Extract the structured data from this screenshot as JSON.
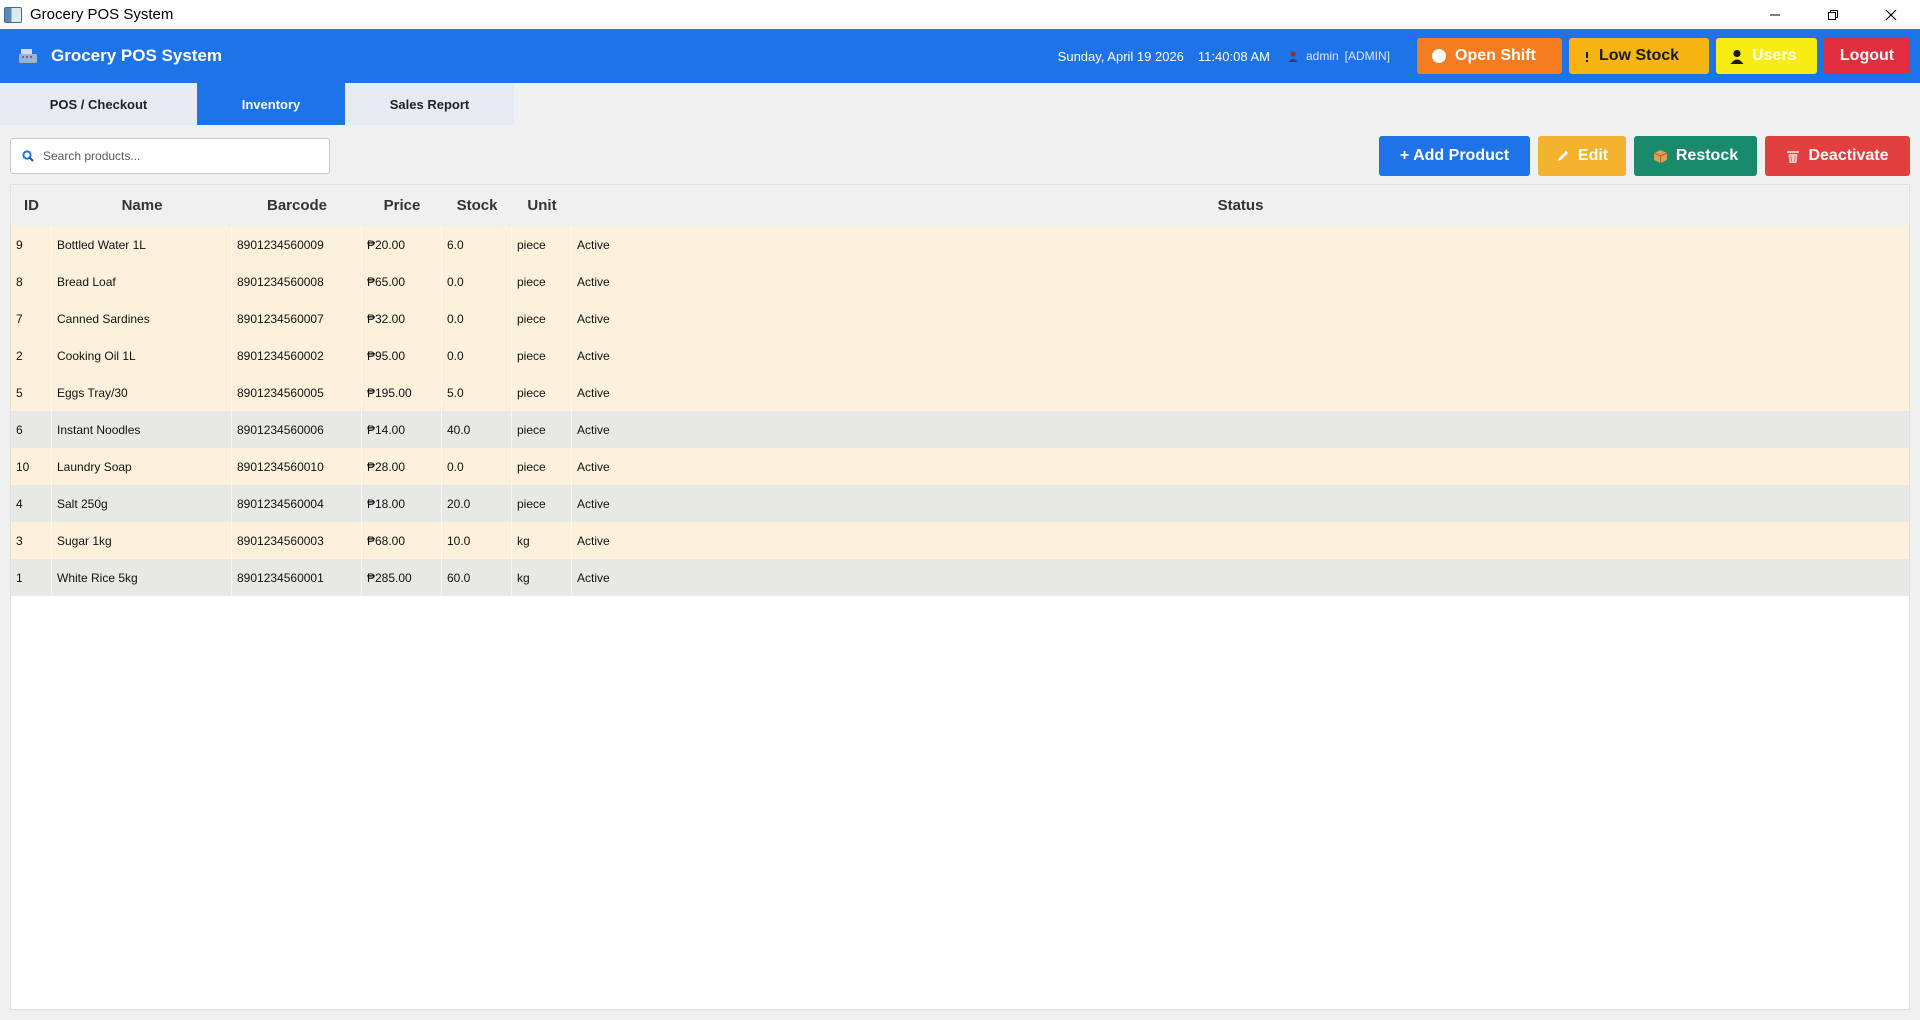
{
  "window": {
    "title": "Grocery POS System"
  },
  "header": {
    "brand": "Grocery POS System",
    "date": "Sunday, April 19 2026",
    "time": "11:40:08 AM",
    "user": "admin",
    "role": "[ADMIN]",
    "buttons": {
      "open_shift": "Open Shift",
      "low_stock": "Low Stock",
      "users": "Users",
      "logout": "Logout"
    }
  },
  "tabs": [
    {
      "label": "POS / Checkout",
      "active": false
    },
    {
      "label": "Inventory",
      "active": true
    },
    {
      "label": "Sales Report",
      "active": false
    }
  ],
  "search": {
    "placeholder": "Search products...",
    "value": ""
  },
  "toolbar": {
    "add": "+ Add Product",
    "edit": "Edit",
    "restock": "Restock",
    "deactivate": "Deactivate"
  },
  "table": {
    "columns": [
      "ID",
      "Name",
      "Barcode",
      "Price",
      "Stock",
      "Unit",
      "Status"
    ],
    "rows": [
      {
        "id": "9",
        "name": "Bottled Water 1L",
        "barcode": "8901234560009",
        "price": "₱20.00",
        "stock": "6.0",
        "unit": "piece",
        "status": "Active",
        "low": true
      },
      {
        "id": "8",
        "name": "Bread Loaf",
        "barcode": "8901234560008",
        "price": "₱65.00",
        "stock": "0.0",
        "unit": "piece",
        "status": "Active",
        "low": true
      },
      {
        "id": "7",
        "name": "Canned Sardines",
        "barcode": "8901234560007",
        "price": "₱32.00",
        "stock": "0.0",
        "unit": "piece",
        "status": "Active",
        "low": true
      },
      {
        "id": "2",
        "name": "Cooking Oil 1L",
        "barcode": "8901234560002",
        "price": "₱95.00",
        "stock": "0.0",
        "unit": "piece",
        "status": "Active",
        "low": true
      },
      {
        "id": "5",
        "name": "Eggs Tray/30",
        "barcode": "8901234560005",
        "price": "₱195.00",
        "stock": "5.0",
        "unit": "piece",
        "status": "Active",
        "low": true
      },
      {
        "id": "6",
        "name": "Instant Noodles",
        "barcode": "8901234560006",
        "price": "₱14.00",
        "stock": "40.0",
        "unit": "piece",
        "status": "Active",
        "low": false
      },
      {
        "id": "10",
        "name": "Laundry Soap",
        "barcode": "8901234560010",
        "price": "₱28.00",
        "stock": "0.0",
        "unit": "piece",
        "status": "Active",
        "low": true
      },
      {
        "id": "4",
        "name": "Salt 250g",
        "barcode": "8901234560004",
        "price": "₱18.00",
        "stock": "20.0",
        "unit": "piece",
        "status": "Active",
        "low": false
      },
      {
        "id": "3",
        "name": "Sugar 1kg",
        "barcode": "8901234560003",
        "price": "₱68.00",
        "stock": "10.0",
        "unit": "kg",
        "status": "Active",
        "low": true
      },
      {
        "id": "1",
        "name": "White Rice 5kg",
        "barcode": "8901234560001",
        "price": "₱285.00",
        "stock": "60.0",
        "unit": "kg",
        "status": "Active",
        "low": false
      }
    ]
  },
  "colors": {
    "header": "#1e73e8",
    "low_stock_row": "#fdf1dc",
    "normal_row": "#e8e8e6",
    "open_shift": "#f57c1f",
    "low_stock": "#f5b40f",
    "users": "#f9ec13",
    "logout": "#e02f3c",
    "restock": "#1a8a6c",
    "deactivate": "#e23f3f"
  },
  "icons": {
    "brand": "register-icon",
    "user": "user-icon",
    "open_shift": "circle-icon",
    "low_stock": "exclamation-icon",
    "users": "users-icon",
    "search": "search-icon",
    "edit": "pencil-icon",
    "restock": "box-icon",
    "deactivate": "trash-icon"
  }
}
